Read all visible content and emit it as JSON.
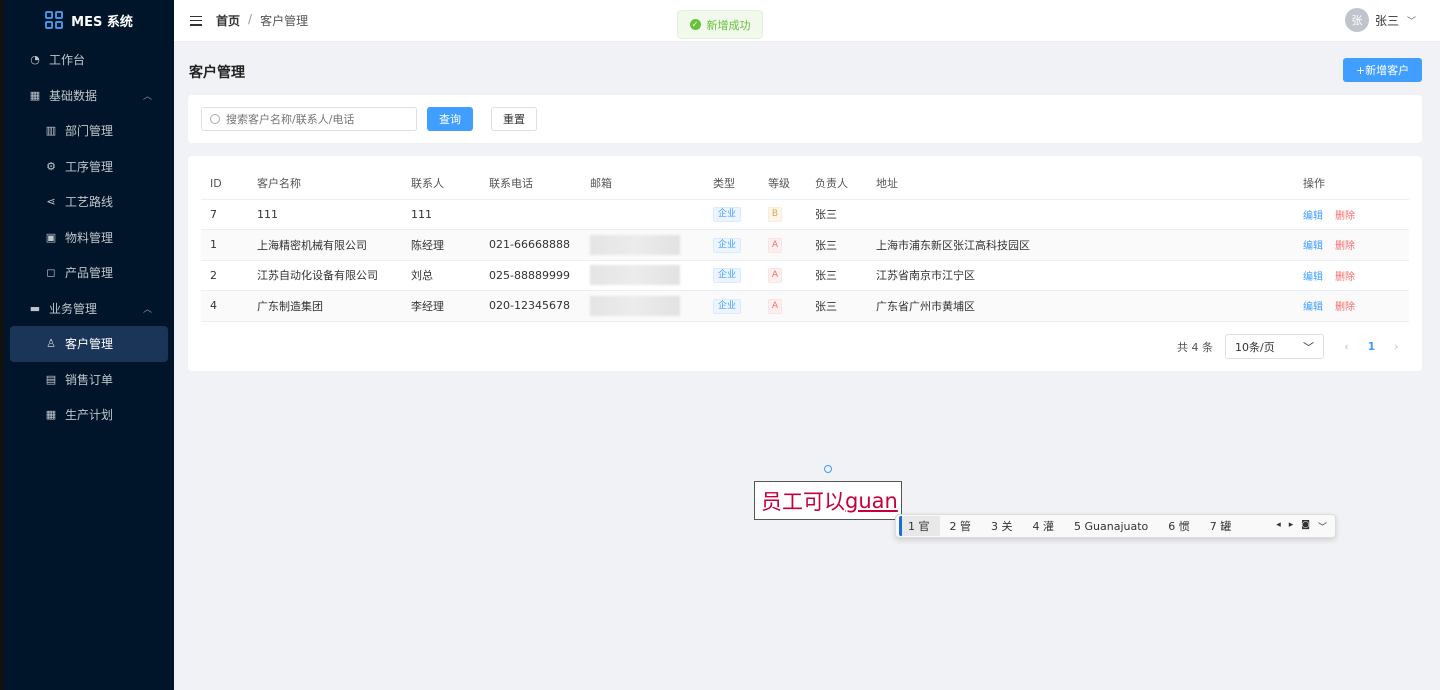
{
  "app": {
    "title": "MES 系统"
  },
  "sidebar": {
    "items": [
      {
        "label": "工作台",
        "icon": "dashboard-icon"
      },
      {
        "label": "基础数据",
        "icon": "grid-icon"
      },
      {
        "label": "部门管理",
        "icon": "building-icon"
      },
      {
        "label": "工序管理",
        "icon": "gear-icon"
      },
      {
        "label": "工艺路线",
        "icon": "share-icon"
      },
      {
        "label": "物料管理",
        "icon": "box-icon"
      },
      {
        "label": "产品管理",
        "icon": "bag-icon"
      },
      {
        "label": "业务管理",
        "icon": "briefcase-icon"
      },
      {
        "label": "客户管理",
        "icon": "user-icon"
      },
      {
        "label": "销售订单",
        "icon": "document-icon"
      },
      {
        "label": "生产计划",
        "icon": "calendar-icon"
      }
    ]
  },
  "header": {
    "breadcrumb_home": "首页",
    "breadcrumb_sep": "/",
    "breadcrumb_current": "客户管理",
    "user_avatar": "张",
    "user_name": "张三"
  },
  "toast": {
    "text": "新增成功",
    "color": "#67c23a"
  },
  "page": {
    "title": "客户管理",
    "add_button": "+新增客户"
  },
  "search": {
    "placeholder": "搜索客户名称/联系人/电话",
    "query_label": "查询",
    "reset_label": "重置"
  },
  "table": {
    "headers": [
      "ID",
      "客户名称",
      "联系人",
      "联系电话",
      "邮箱",
      "类型",
      "等级",
      "负责人",
      "地址",
      "操作"
    ],
    "rows": [
      {
        "id": "7",
        "name": "111",
        "contact": "111",
        "phone": "",
        "type": "企业",
        "level": "B",
        "owner": "张三",
        "address": "",
        "edit": "编辑",
        "delete": "删除"
      },
      {
        "id": "1",
        "name": "上海精密机械有限公司",
        "contact": "陈经理",
        "phone": "021-66668888",
        "type": "企业",
        "level": "A",
        "owner": "张三",
        "address": "上海市浦东新区张江高科技园区",
        "edit": "编辑",
        "delete": "删除"
      },
      {
        "id": "2",
        "name": "江苏自动化设备有限公司",
        "contact": "刘总",
        "phone": "025-88889999",
        "type": "企业",
        "level": "A",
        "owner": "张三",
        "address": "江苏省南京市江宁区",
        "edit": "编辑",
        "delete": "删除"
      },
      {
        "id": "4",
        "name": "广东制造集团",
        "contact": "李经理",
        "phone": "020-12345678",
        "type": "企业",
        "level": "A",
        "owner": "张三",
        "address": "广东省广州市黄埔区",
        "edit": "编辑",
        "delete": "删除"
      }
    ]
  },
  "pagination": {
    "total": "共 4 条",
    "page_size": "10条/页",
    "current_page": "1"
  },
  "ime": {
    "committed": "员工可以",
    "composing": "guan",
    "candidates": [
      "1 官",
      "2 管",
      "3 关",
      "4 灌",
      "5 Guanajuato",
      "6 惯",
      "7 罐"
    ]
  },
  "colors": {
    "accent": "#409eff",
    "sidebar_bg": "#001529",
    "danger": "#f56c6c"
  }
}
